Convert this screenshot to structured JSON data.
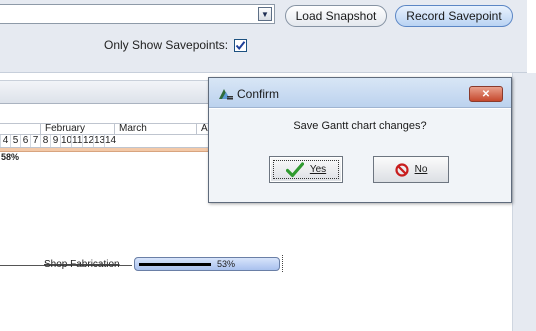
{
  "toolbar": {
    "snapshot_select_value": "",
    "load_snapshot_label": "Load Snapshot",
    "record_savepoint_label": "Record Savepoint",
    "only_show_savepoints_label": "Only Show Savepoints:",
    "only_show_savepoints_checked": true
  },
  "gantt": {
    "months": [
      "February",
      "March",
      "A"
    ],
    "days": [
      "4",
      "5",
      "6",
      "7",
      "8",
      "9",
      "10",
      "11",
      "12",
      "13",
      "14"
    ],
    "summary_percent": "58%",
    "tasks": [
      {
        "name": "Shop Fabrication",
        "percent": "53%",
        "progress": 0.53
      }
    ]
  },
  "dialog": {
    "title": "Confirm",
    "message": "Save Gantt chart changes?",
    "yes_label": "Yes",
    "no_label": "No"
  },
  "colors": {
    "panel_bg": "#e6eaf1",
    "record_button_accent": "#5b86c5",
    "summary_bar": "#f3c9a8",
    "task_bar": "#a9c1ee",
    "close_button": "#c5482d"
  }
}
